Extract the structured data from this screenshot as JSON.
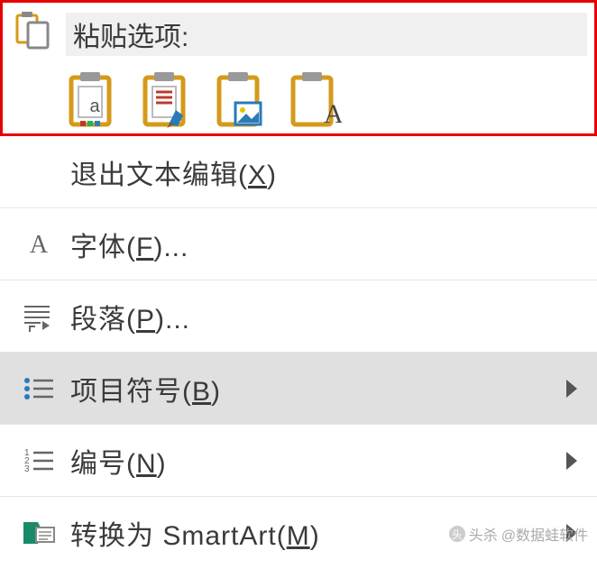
{
  "paste_section": {
    "title": "粘贴选项:",
    "options": [
      {
        "name": "keep-source-formatting"
      },
      {
        "name": "keep-text-only-brush"
      },
      {
        "name": "picture"
      },
      {
        "name": "text-only"
      }
    ]
  },
  "menu_items": [
    {
      "id": "exit-text-edit",
      "label": "退出文本编辑",
      "hotkey": "X",
      "has_submenu": false
    },
    {
      "id": "font",
      "label": "字体",
      "hotkey": "F",
      "suffix": "...",
      "has_submenu": false,
      "icon": "letter-a"
    },
    {
      "id": "paragraph",
      "label": "段落",
      "hotkey": "P",
      "suffix": "...",
      "has_submenu": false,
      "icon": "paragraph"
    },
    {
      "id": "bullets",
      "label": "项目符号",
      "hotkey": "B",
      "has_submenu": true,
      "icon": "bullets",
      "hover": true
    },
    {
      "id": "numbering",
      "label": "编号",
      "hotkey": "N",
      "has_submenu": true,
      "icon": "numbering"
    },
    {
      "id": "smartart",
      "label": "转换为 SmartArt",
      "hotkey": "M",
      "has_submenu": true,
      "icon": "smartart"
    }
  ],
  "watermark": {
    "prefix": "头杀",
    "author": "@数据蛙软件"
  }
}
